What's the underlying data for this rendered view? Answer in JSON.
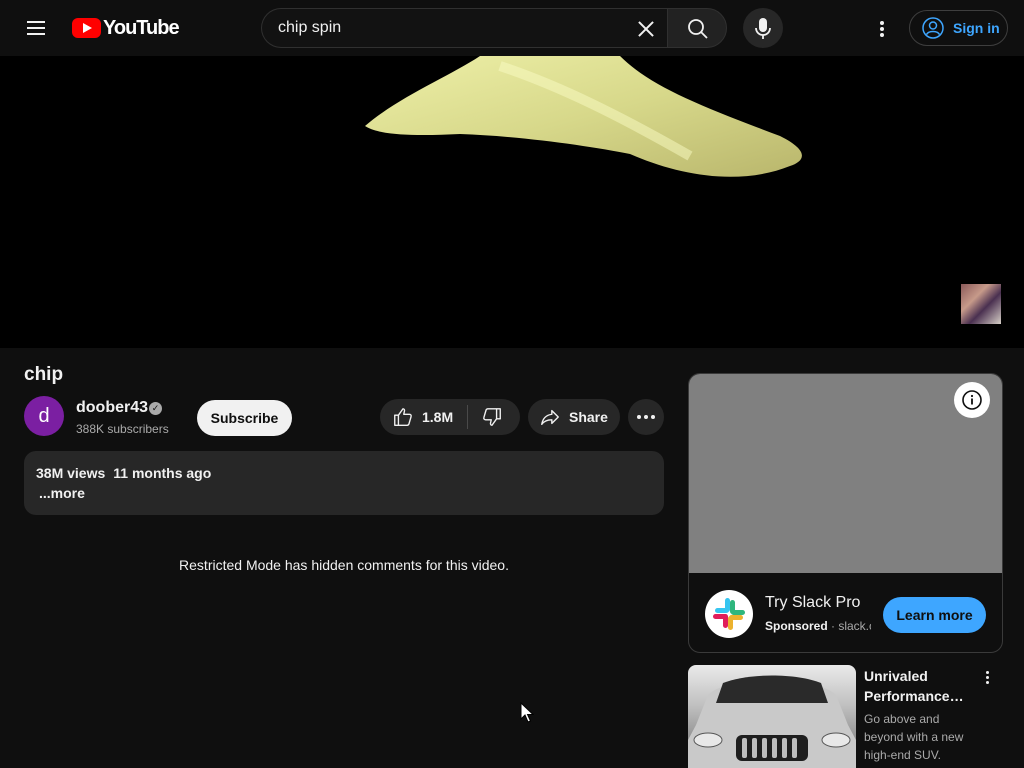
{
  "header": {
    "search_value": "chip spin",
    "logo_text": "YouTube",
    "signin_label": "Sign in"
  },
  "video": {
    "title": "chip",
    "channel": {
      "name": "doober43",
      "avatar_letter": "d",
      "subscribers": "388K subscribers",
      "avatar_color": "#7b1fa2"
    },
    "subscribe_label": "Subscribe",
    "likes": "1.8M",
    "share_label": "Share",
    "views": "38M views",
    "age": "11 months ago",
    "more_label": "...more"
  },
  "comments_notice": "Restricted Mode has hidden comments for this video.",
  "ad": {
    "title": "Try Slack Pro",
    "sponsored_label": "Sponsored",
    "domain": "slack.com",
    "cta_label": "Learn more",
    "accent": "#3ea6ff"
  },
  "recommended": [
    {
      "title": "Unrivaled Performance…",
      "description": "Go above and beyond with a new high-end SUV."
    }
  ],
  "colors": {
    "background": "#0f0f0f",
    "surface": "#272727",
    "link": "#3ea6ff",
    "brand": "#ff0000"
  }
}
